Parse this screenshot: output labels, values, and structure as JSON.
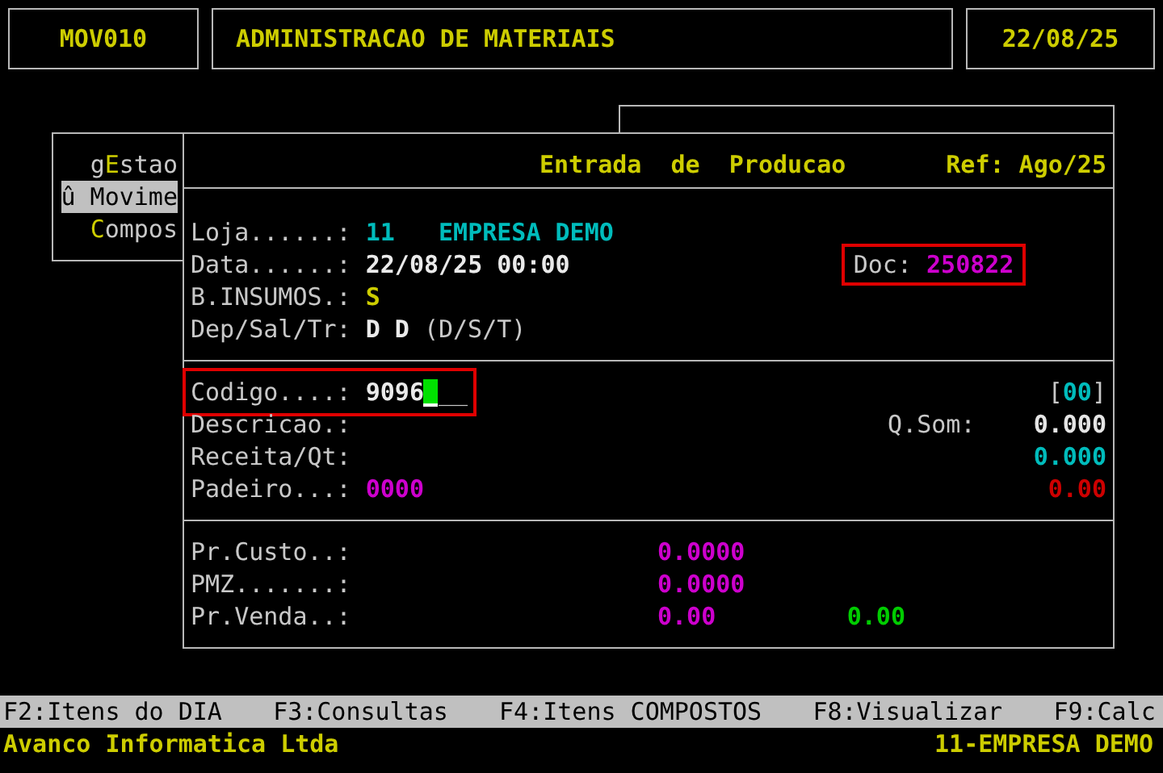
{
  "header": {
    "code": "MOV010",
    "title": "ADMINISTRACAO DE MATERIAIS",
    "date": "22/08/25"
  },
  "side_menu": [
    {
      "before": "g",
      "hotkey": "E",
      "after": "stao",
      "selected": false
    },
    {
      "before": "û Movime",
      "selected": true
    },
    {
      "hotkey": "C",
      "after": "ompos",
      "selected": false
    }
  ],
  "form": {
    "title": "Entrada  de  Producao",
    "ref": "Ref: Ago/25",
    "sections": [
      {
        "kind": "fields",
        "lines": [
          {
            "label": "Loja......:",
            "parts": [
              {
                "kind": "value",
                "text": "11   EMPRESA DEMO",
                "color": "#00bcbc"
              }
            ]
          },
          {
            "label": "Data......:",
            "parts": [
              {
                "kind": "strong",
                "text": "22/08/25 00:00"
              }
            ],
            "side": {
              "label": "Doc:",
              "value": "250822",
              "color": "#cd00cd",
              "highlighted": true
            }
          },
          {
            "label": "B.INSUMOS.:",
            "parts": [
              {
                "kind": "value",
                "text": "S",
                "color": "#cdcd00"
              }
            ]
          },
          {
            "label": "Dep/Sal/Tr:",
            "parts": [
              {
                "kind": "strong",
                "text": "D D"
              },
              {
                "kind": "hint",
                "text": "(D/S/T)"
              }
            ]
          }
        ]
      },
      {
        "kind": "fields",
        "lines": [
          {
            "label": "Codigo....:",
            "highlighted": true,
            "parts": [
              {
                "kind": "strong",
                "text": "9096"
              },
              {
                "kind": "cursor"
              },
              {
                "kind": "mask",
                "text": "__"
              }
            ],
            "right": {
              "before": "[",
              "value": "00",
              "after": "]",
              "color": "#00bcbc"
            }
          },
          {
            "label": "Descricao.:",
            "right": {
              "label": "Q.Som:",
              "value": "0.000",
              "color": "#e5e5e5"
            }
          },
          {
            "label": "Receita/Qt:",
            "right": {
              "value": "0.000",
              "color": "#00bcbc"
            }
          },
          {
            "label": "Padeiro...:",
            "parts": [
              {
                "kind": "value",
                "text": "0000",
                "color": "#cd00cd"
              }
            ],
            "right": {
              "value": "0.00",
              "color": "#cd0000"
            }
          }
        ]
      },
      {
        "kind": "prices",
        "lines": [
          {
            "label": "Pr.Custo..:",
            "values": [
              {
                "text": "0.0000",
                "color": "#cd00cd"
              }
            ]
          },
          {
            "label": "PMZ.......:",
            "values": [
              {
                "text": "0.0000",
                "color": "#cd00cd"
              }
            ]
          },
          {
            "label": "Pr.Venda..:",
            "values": [
              {
                "text": "0.00",
                "color": "#cd00cd"
              },
              {
                "text": "0.00",
                "color": "#00cd00"
              }
            ]
          }
        ]
      }
    ]
  },
  "function_keys": [
    "F2:Itens do DIA",
    "F3:Consultas",
    "F4:Itens COMPOSTOS",
    "F8:Visualizar",
    "F9:Calc"
  ],
  "status_bar": {
    "company": "Avanco Informatica Ltda",
    "branch": "11-EMPRESA DEMO"
  }
}
